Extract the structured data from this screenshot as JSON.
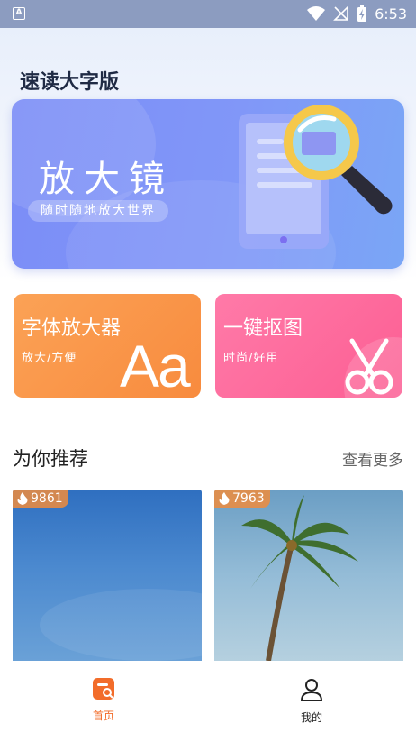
{
  "status_bar": {
    "app_badge": "A",
    "time": "6:53",
    "icons": [
      "wifi-icon",
      "no-signal-icon",
      "battery-charging-icon"
    ]
  },
  "app": {
    "title": "速读大字版"
  },
  "banner": {
    "title": "放大镜",
    "subtitle": "随时随地放大世界"
  },
  "cards": [
    {
      "name": "字体放大器",
      "desc": "放大/方便",
      "art": "Aa",
      "color": "#f99647"
    },
    {
      "name": "一键抠图",
      "desc": "时尚/好用",
      "art": "scissors-icon",
      "color": "#fd6c9c"
    }
  ],
  "recommend": {
    "title": "为你推荐",
    "more": "查看更多",
    "items": [
      {
        "count": "9861",
        "image": "blue-sky"
      },
      {
        "count": "7963",
        "image": "palm-tree"
      }
    ]
  },
  "tabbar": {
    "active_color": "#f26c2a",
    "tabs": [
      {
        "label": "首页",
        "icon": "home-doc-icon",
        "active": true
      },
      {
        "label": "我的",
        "icon": "user-icon",
        "active": false
      }
    ]
  }
}
